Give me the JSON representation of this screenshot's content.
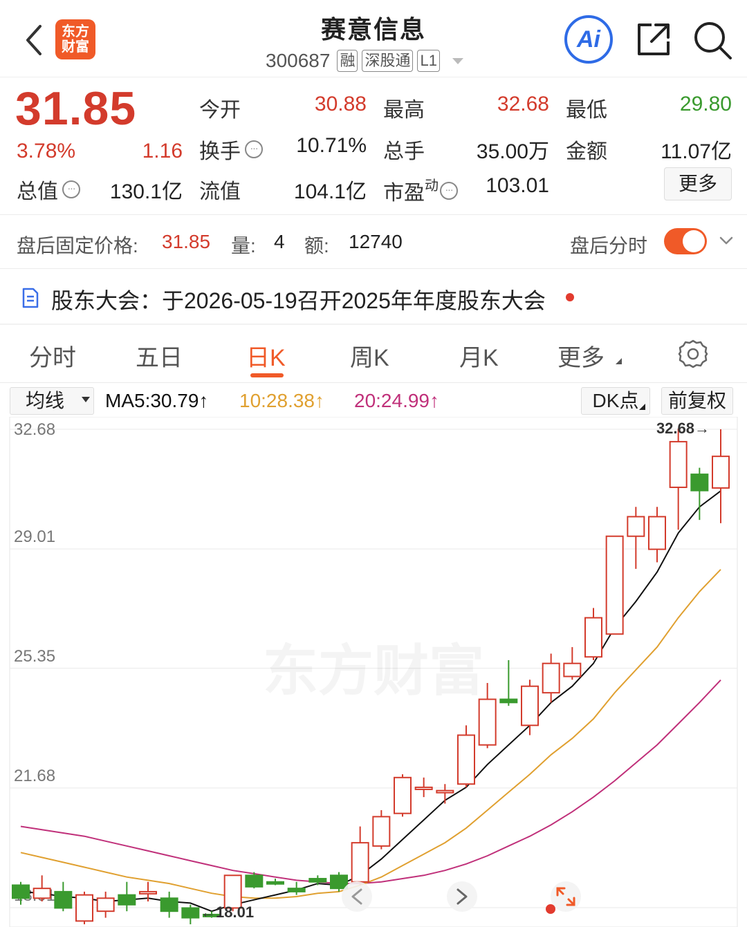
{
  "header": {
    "logo_line1": "东方",
    "logo_line2": "财富",
    "title": "赛意信息",
    "code": "300687",
    "tags": [
      "融",
      "深股通",
      "L1"
    ],
    "ai_label": "Ai"
  },
  "quote": {
    "price": "31.85",
    "change_pct": "3.78%",
    "change": "1.16",
    "open_label": "今开",
    "open": "30.88",
    "high_label": "最高",
    "high": "32.68",
    "low_label": "最低",
    "low": "29.80",
    "turnover_label": "换手",
    "turnover": "10.71%",
    "volume_label": "总手",
    "volume": "35.00万",
    "amount_label": "金额",
    "amount": "11.07亿",
    "total_mv_label": "总值",
    "total_mv": "130.1亿",
    "float_mv_label": "流值",
    "float_mv": "104.1亿",
    "pe_label": "市盈",
    "pe_sup": "动",
    "pe": "103.01",
    "more_label": "更多",
    "colors": {
      "up": "#d33b2c",
      "down": "#3a9a2e"
    }
  },
  "after_hours": {
    "price_label": "盘后固定价格:",
    "price": "31.85",
    "qty_label": "量:",
    "qty": "4",
    "amt_label": "额:",
    "amt": "12740",
    "toggle_label": "盘后分时"
  },
  "notice": {
    "text": "股东大会：于2026-05-19召开2025年年度股东大会"
  },
  "tabs": {
    "items": [
      "分时",
      "五日",
      "日K",
      "周K",
      "月K",
      "更多"
    ],
    "active": "日K"
  },
  "ma_bar": {
    "select": "均线",
    "ma5": "MA5:30.79↑",
    "ma10": "10:28.38↑",
    "ma20": "20:24.99↑",
    "dk": "DK点",
    "adjust": "前复权",
    "colors": {
      "ma5": "#111111",
      "ma10": "#e0a030",
      "ma20": "#c0307a"
    }
  },
  "chart_data": {
    "type": "candlestick",
    "y_axis_labels": [
      "32.68",
      "29.01",
      "25.35",
      "21.68",
      "18.01"
    ],
    "ylim": [
      18.01,
      32.68
    ],
    "high_marker": "32.68→",
    "low_marker": "←18.01",
    "watermark": "东方财富",
    "candles": [
      {
        "o": 18.7,
        "c": 18.3,
        "h": 18.8,
        "l": 18.1
      },
      {
        "o": 18.3,
        "c": 18.6,
        "h": 19.0,
        "l": 18.2
      },
      {
        "o": 18.5,
        "c": 18.0,
        "h": 18.8,
        "l": 17.9
      },
      {
        "o": 17.6,
        "c": 18.4,
        "h": 18.5,
        "l": 17.5
      },
      {
        "o": 17.9,
        "c": 18.3,
        "h": 18.5,
        "l": 17.7
      },
      {
        "o": 18.4,
        "c": 18.1,
        "h": 18.8,
        "l": 17.9
      },
      {
        "o": 18.5,
        "c": 18.5,
        "h": 18.8,
        "l": 18.2
      },
      {
        "o": 18.3,
        "c": 17.9,
        "h": 18.5,
        "l": 17.7
      },
      {
        "o": 18.0,
        "c": 17.7,
        "h": 18.1,
        "l": 17.5
      },
      {
        "o": 17.8,
        "c": 17.75,
        "h": 17.9,
        "l": 17.7
      },
      {
        "o": 18.0,
        "c": 19.0,
        "h": 19.0,
        "l": 17.9
      },
      {
        "o": 19.0,
        "c": 18.65,
        "h": 19.1,
        "l": 18.6
      },
      {
        "o": 18.8,
        "c": 18.75,
        "h": 18.9,
        "l": 18.7
      },
      {
        "o": 18.6,
        "c": 18.5,
        "h": 18.8,
        "l": 18.4
      },
      {
        "o": 18.9,
        "c": 18.8,
        "h": 19.0,
        "l": 18.7
      },
      {
        "o": 19.0,
        "c": 18.6,
        "h": 19.1,
        "l": 18.5
      },
      {
        "o": 18.8,
        "c": 20.0,
        "h": 20.5,
        "l": 18.7
      },
      {
        "o": 19.9,
        "c": 20.8,
        "h": 21.0,
        "l": 19.8
      },
      {
        "o": 20.9,
        "c": 22.0,
        "h": 22.1,
        "l": 20.8
      },
      {
        "o": 21.7,
        "c": 21.7,
        "h": 22.0,
        "l": 21.4
      },
      {
        "o": 21.6,
        "c": 21.6,
        "h": 21.8,
        "l": 21.2
      },
      {
        "o": 21.8,
        "c": 23.3,
        "h": 23.6,
        "l": 21.7
      },
      {
        "o": 23.0,
        "c": 24.4,
        "h": 24.9,
        "l": 22.9
      },
      {
        "o": 24.4,
        "c": 24.3,
        "h": 25.6,
        "l": 24.2
      },
      {
        "o": 23.6,
        "c": 24.8,
        "h": 25.0,
        "l": 23.3
      },
      {
        "o": 24.6,
        "c": 25.5,
        "h": 25.8,
        "l": 24.3
      },
      {
        "o": 25.1,
        "c": 25.5,
        "h": 26.0,
        "l": 25.0
      },
      {
        "o": 25.7,
        "c": 26.9,
        "h": 27.2,
        "l": 25.6
      },
      {
        "o": 26.4,
        "c": 29.4,
        "h": 29.4,
        "l": 26.4
      },
      {
        "o": 29.4,
        "c": 30.0,
        "h": 30.3,
        "l": 28.4
      },
      {
        "o": 29.0,
        "c": 30.0,
        "h": 30.3,
        "l": 28.6
      },
      {
        "o": 30.9,
        "c": 32.3,
        "h": 32.7,
        "l": 29.6
      },
      {
        "o": 31.3,
        "c": 30.8,
        "h": 31.5,
        "l": 29.9
      },
      {
        "o": 30.88,
        "c": 31.85,
        "h": 32.68,
        "l": 29.8
      }
    ],
    "ma5": [
      18.5,
      18.45,
      18.35,
      18.3,
      18.2,
      18.25,
      18.3,
      18.2,
      18.15,
      17.9,
      18.1,
      18.25,
      18.4,
      18.55,
      18.75,
      18.7,
      19.0,
      19.5,
      20.1,
      20.7,
      21.3,
      21.7,
      22.4,
      23.0,
      23.6,
      24.3,
      24.8,
      25.5,
      26.6,
      27.4,
      28.3,
      29.5,
      30.3,
      30.79
    ],
    "ma10": [
      19.7,
      19.55,
      19.4,
      19.25,
      19.1,
      18.95,
      18.85,
      18.75,
      18.6,
      18.45,
      18.35,
      18.3,
      18.3,
      18.35,
      18.45,
      18.5,
      18.7,
      18.95,
      19.3,
      19.65,
      20.0,
      20.45,
      21.0,
      21.55,
      22.1,
      22.7,
      23.2,
      23.8,
      24.6,
      25.3,
      26.0,
      26.9,
      27.7,
      28.38
    ],
    "ma20": [
      20.5,
      20.4,
      20.3,
      20.2,
      20.05,
      19.9,
      19.75,
      19.6,
      19.45,
      19.3,
      19.15,
      19.05,
      18.95,
      18.85,
      18.8,
      18.75,
      18.75,
      18.8,
      18.9,
      19.0,
      19.15,
      19.35,
      19.6,
      19.9,
      20.2,
      20.55,
      20.95,
      21.4,
      21.9,
      22.45,
      23.0,
      23.65,
      24.3,
      24.99
    ]
  }
}
